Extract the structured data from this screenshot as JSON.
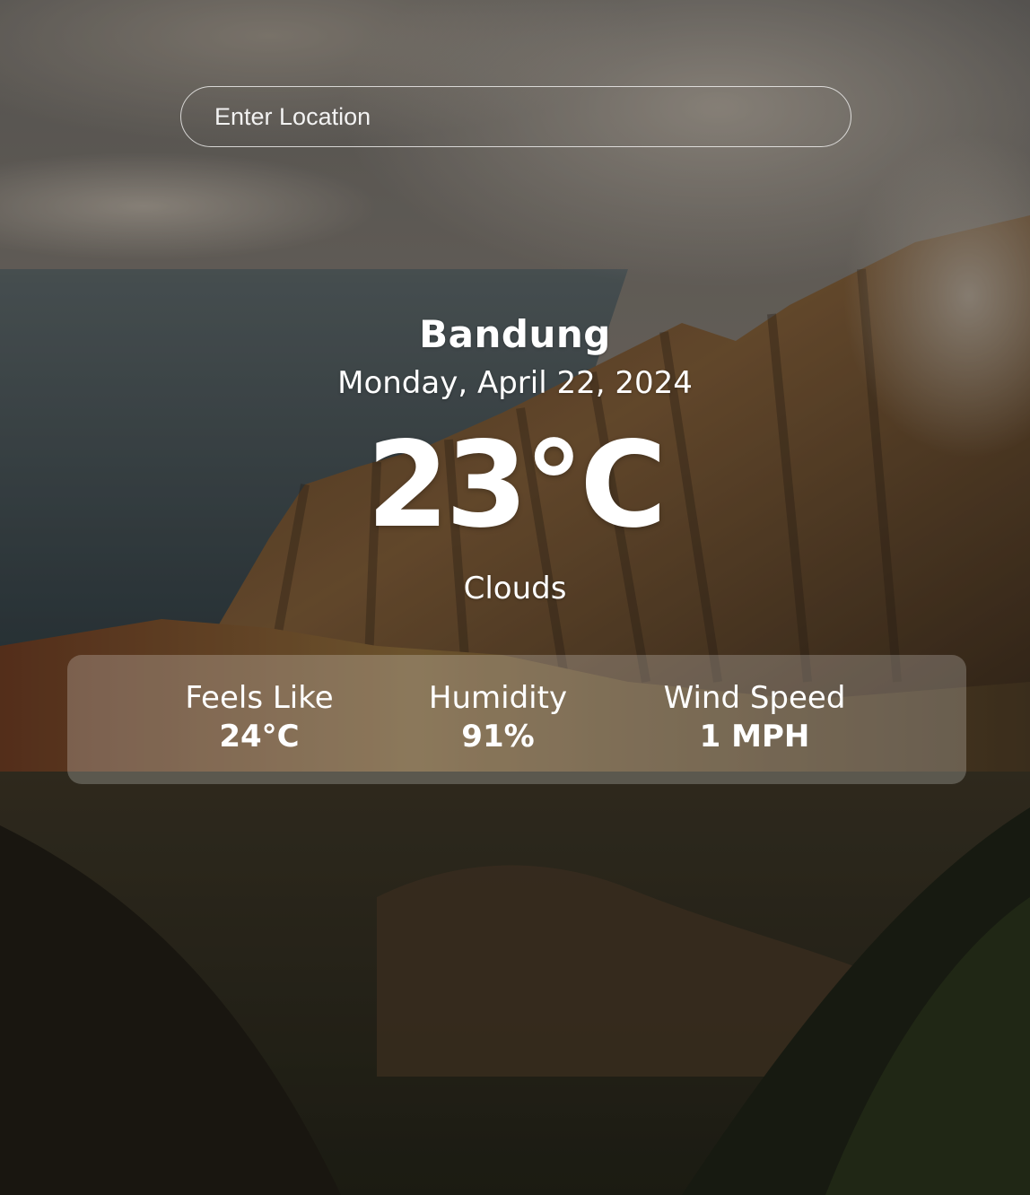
{
  "search": {
    "placeholder": "Enter Location"
  },
  "weather": {
    "location": "Bandung",
    "date": "Monday, April 22, 2024",
    "temperature": "23°C",
    "condition": "Clouds"
  },
  "details": {
    "feels_like": {
      "label": "Feels Like",
      "value": "24°C"
    },
    "humidity": {
      "label": "Humidity",
      "value": "91%"
    },
    "wind_speed": {
      "label": "Wind Speed",
      "value": "1 MPH"
    }
  },
  "background": {
    "description": "mountain valley with sea and clouds",
    "colors": {
      "sky": "#8a8074",
      "sea": "#3f4f55",
      "mountain_light": "#7a5a38",
      "mountain_dark": "#2e2a1f",
      "foreground": "#1f2317"
    }
  }
}
